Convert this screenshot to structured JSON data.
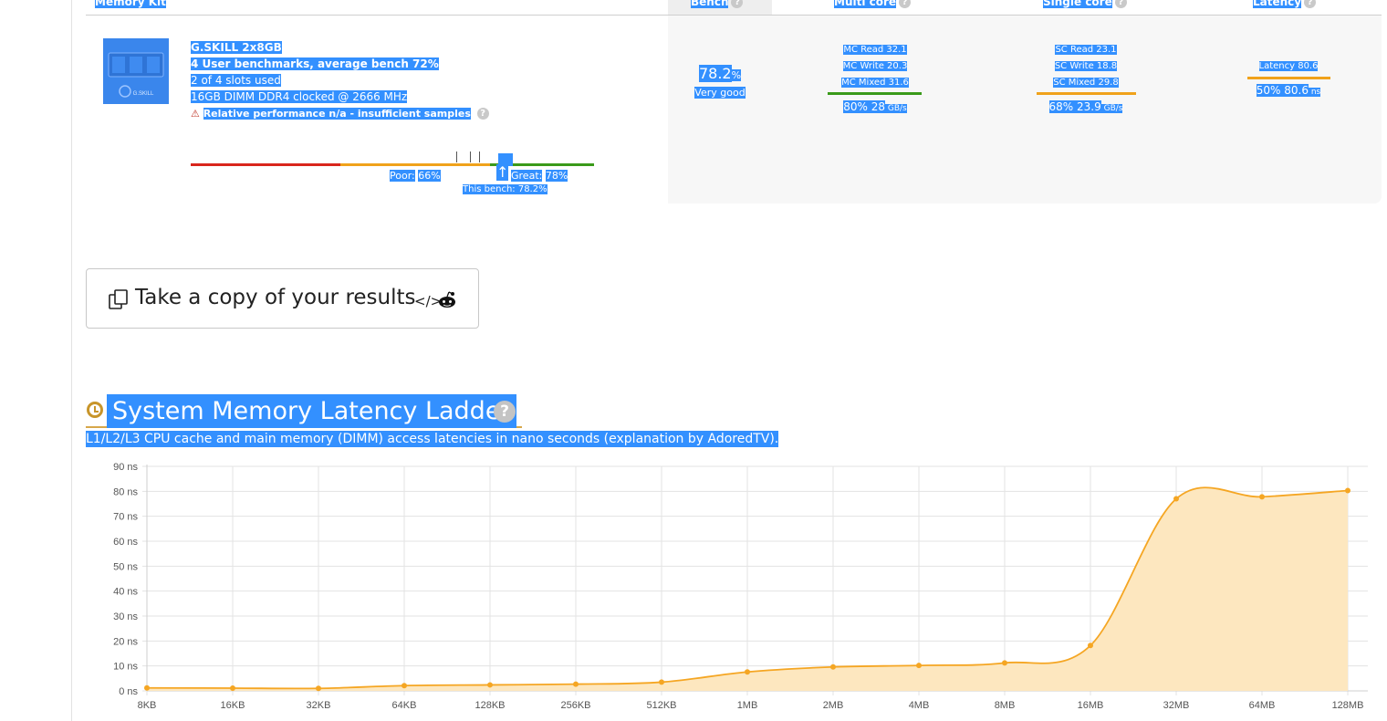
{
  "table_header": {
    "memory_kit": "Memory Kit",
    "bench": "Bench",
    "multi_core": "Multi core",
    "single_core": "Single core",
    "latency": "Latency",
    "help_icon": "?"
  },
  "kit": {
    "name": "G.SKILL 2x8GB",
    "benchmarks": "4 User benchmarks, average bench 72%",
    "slots": "2 of 4 slots used",
    "spec": "16GB DIMM DDR4 clocked @ 2666 MHz",
    "warning": "Relative performance n/a - insufficient samples",
    "thumb_logo": "G.SKILL",
    "perf_bar": {
      "poor_label": "Poor:",
      "poor_value": "66%",
      "great_label": "Great:",
      "great_value": "78%",
      "this_bench": "This bench: 78.2%",
      "this_bench_value": 78.2
    }
  },
  "bench": {
    "score": "78.2",
    "score_unit": "%",
    "rating": "Very good"
  },
  "multi_core": {
    "read": "MC Read 32.1",
    "write": "MC Write 20.3",
    "mixed": "MC Mixed 31.6",
    "summary": "80% 28",
    "unit": "GB/s"
  },
  "single_core": {
    "read": "SC Read 23.1",
    "write": "SC Write 18.8",
    "mixed": "SC Mixed 29.8",
    "summary": "68% 23.9",
    "unit": "GB/s"
  },
  "latency": {
    "value": "Latency 80.6",
    "summary": "50% 80.6",
    "unit": "ns"
  },
  "copy_button": {
    "label": "Take a copy of your results",
    "code_icon": "</>"
  },
  "section": {
    "title": "System Memory Latency Ladder",
    "help_icon": "?",
    "subtitle": "L1/L2/L3 CPU cache and main memory (DIMM) access latencies in nano seconds (explanation by AdoredTV)."
  },
  "colors": {
    "selection": "#3390ff",
    "poor_red": "#d9261c",
    "mid_orange": "#f0a21b",
    "good_green": "#3a9a1a",
    "line_orange": "#f5a623",
    "fill_orange": "#fde7bf"
  },
  "chart_data": {
    "type": "area",
    "title": "",
    "xlabel": "",
    "ylabel": "",
    "categories": [
      "8KB",
      "16KB",
      "32KB",
      "64KB",
      "128KB",
      "256KB",
      "512KB",
      "1MB",
      "2MB",
      "4MB",
      "8MB",
      "16MB",
      "32MB",
      "64MB",
      "128MB"
    ],
    "values": [
      1.2,
      1.1,
      1.0,
      2.1,
      2.4,
      2.7,
      3.5,
      7.6,
      9.6,
      10.2,
      11.2,
      18.2,
      77.0,
      77.8,
      80.3
    ],
    "y_ticks": [
      "0 ns",
      "10 ns",
      "20 ns",
      "30 ns",
      "40 ns",
      "50 ns",
      "60 ns",
      "70 ns",
      "80 ns",
      "90 ns"
    ],
    "ylim": [
      0,
      90
    ],
    "grid": true
  }
}
